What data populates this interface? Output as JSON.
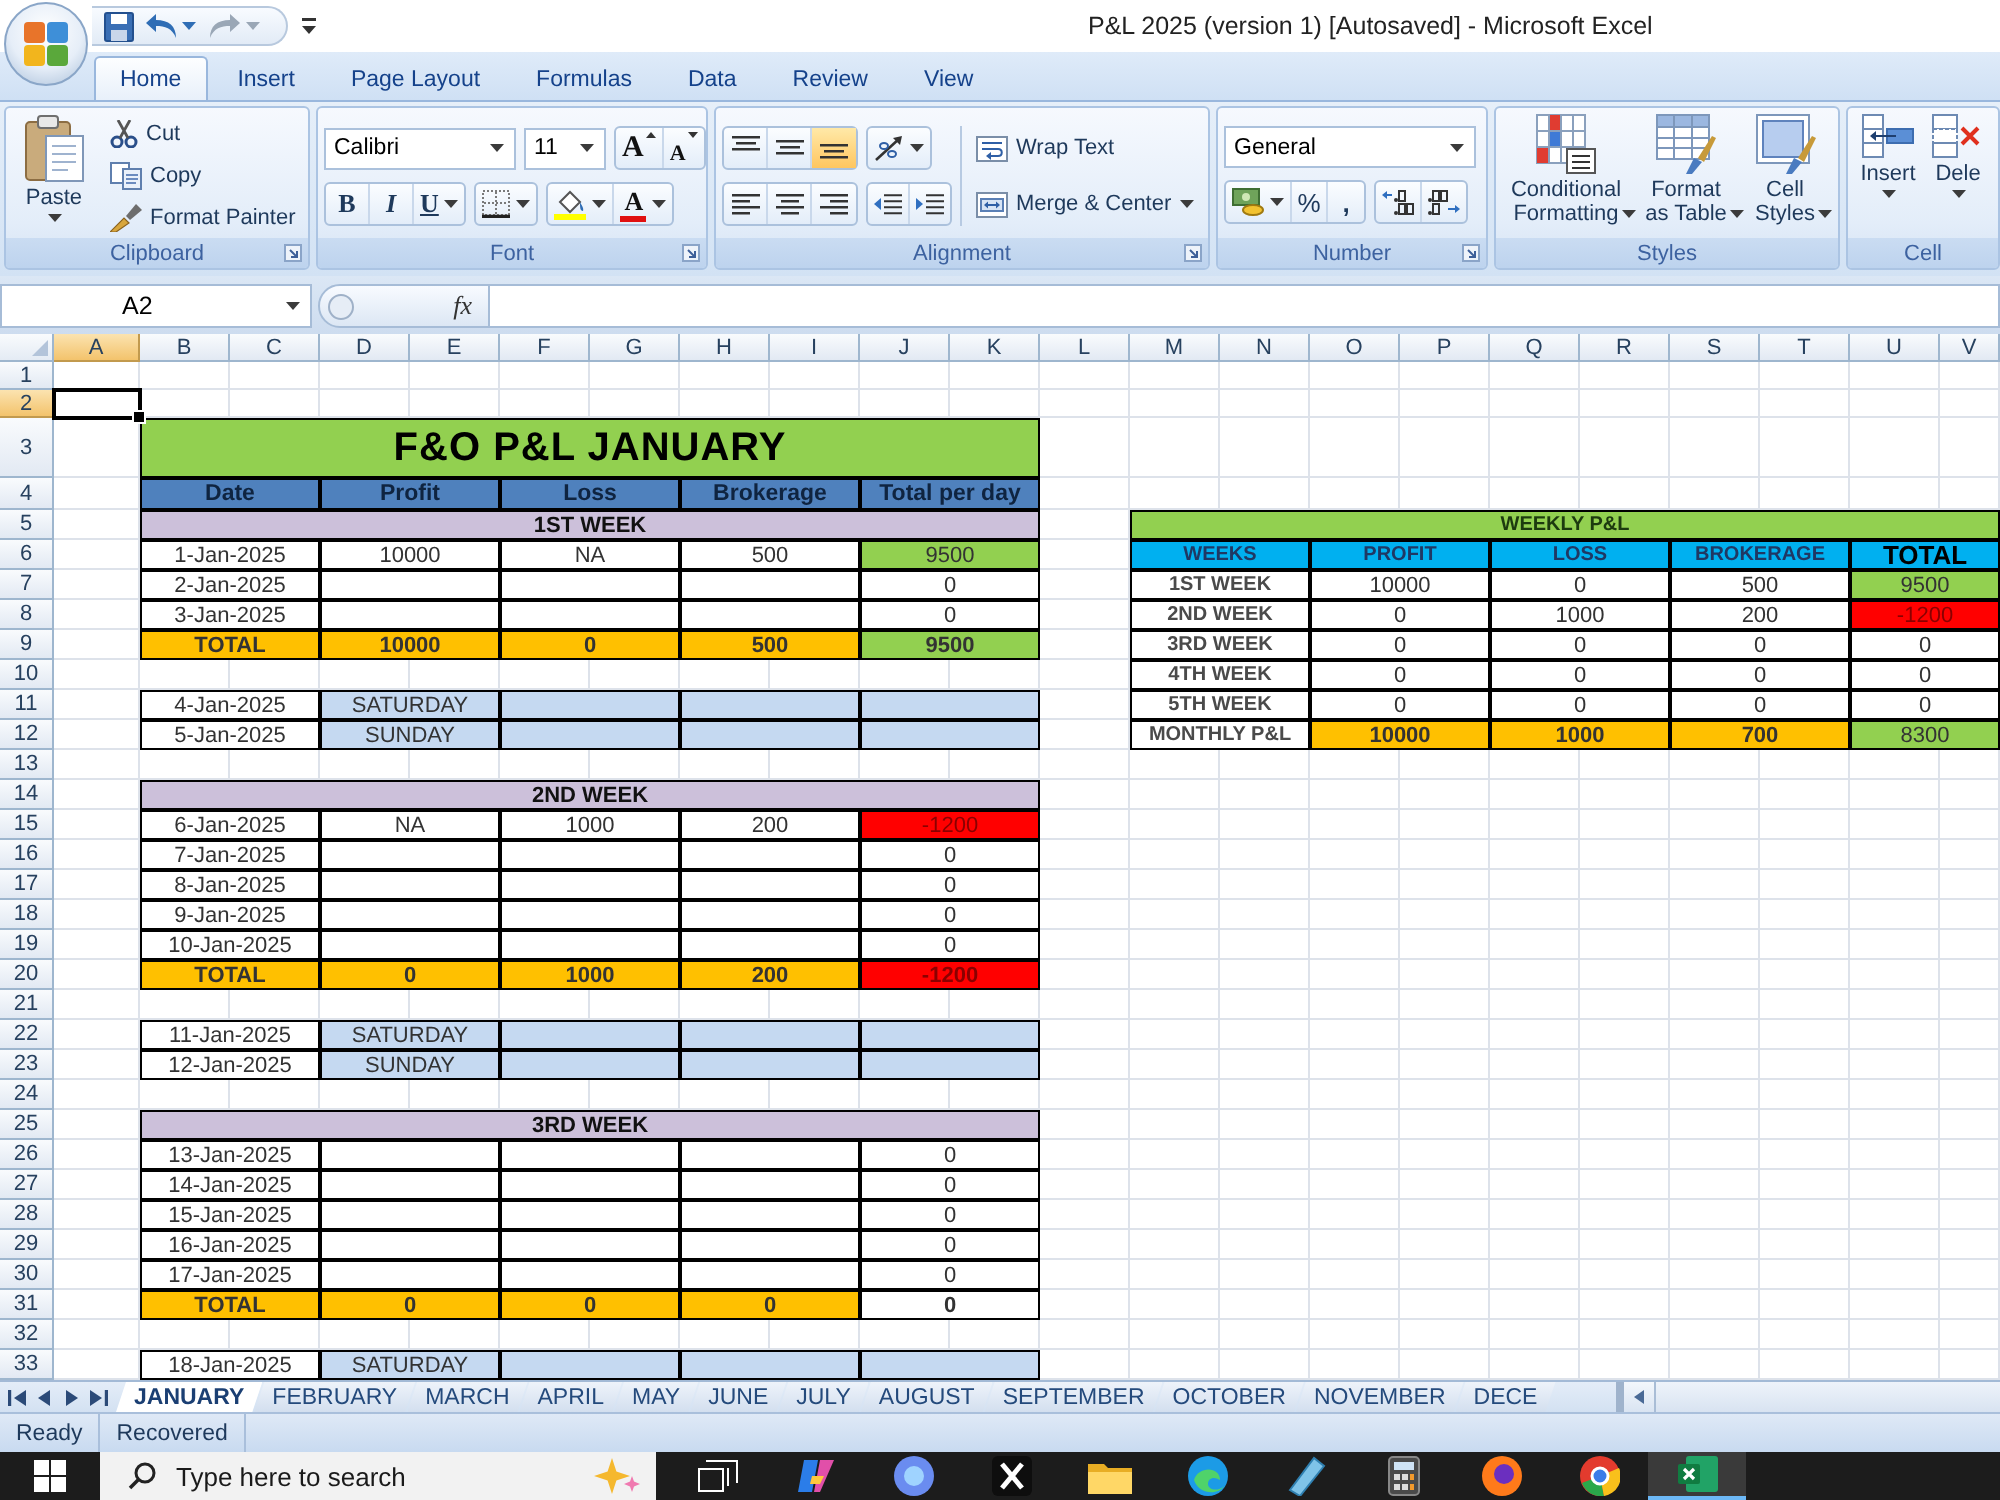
{
  "window": {
    "title": "P&L 2025 (version 1) [Autosaved] - Microsoft Excel"
  },
  "quick_access": {
    "undo": {
      "disabled": false
    },
    "redo": {
      "disabled": true
    }
  },
  "ribbon": {
    "tabs": [
      {
        "label": "Home",
        "selected": true
      },
      {
        "label": "Insert",
        "selected": false
      },
      {
        "label": "Page Layout",
        "selected": false
      },
      {
        "label": "Formulas",
        "selected": false
      },
      {
        "label": "Data",
        "selected": false
      },
      {
        "label": "Review",
        "selected": false
      },
      {
        "label": "View",
        "selected": false
      }
    ],
    "clipboard": {
      "label": "Clipboard",
      "paste": "Paste",
      "commands": [
        "Cut",
        "Copy",
        "Format Painter"
      ]
    },
    "font": {
      "label": "Font",
      "font_name": "Calibri",
      "font_size": "11",
      "grow": "A",
      "shrink": "A",
      "styles": [
        "B",
        "I",
        "U"
      ],
      "font_color": "A"
    },
    "alignment": {
      "label": "Alignment",
      "vertical": [
        {
          "selected": false
        },
        {
          "selected": false
        },
        {
          "selected": true
        }
      ],
      "wrap_text": "Wrap Text",
      "merge": "Merge & Center"
    },
    "number": {
      "label": "Number",
      "format": "General",
      "percent": "%",
      "comma": ","
    },
    "styles": {
      "label": "Styles",
      "commands": [
        "Conditional Formatting",
        "Format as Table",
        "Cell Styles"
      ]
    },
    "cells": {
      "label": "Cell",
      "commands": [
        "Insert",
        "Dele"
      ]
    }
  },
  "formula_bar": {
    "name_box": "A2",
    "function_label": "fx"
  },
  "sheet": {
    "columns": [
      {
        "label": "A",
        "selected": true
      },
      {
        "label": "B",
        "selected": false
      },
      {
        "label": "C",
        "selected": false
      },
      {
        "label": "D",
        "selected": false
      },
      {
        "label": "E",
        "selected": false
      },
      {
        "label": "F",
        "selected": false
      },
      {
        "label": "G",
        "selected": false
      },
      {
        "label": "H",
        "selected": false
      },
      {
        "label": "I",
        "selected": false
      },
      {
        "label": "J",
        "selected": false
      },
      {
        "label": "K",
        "selected": false
      },
      {
        "label": "L",
        "selected": false
      },
      {
        "label": "M",
        "selected": false
      },
      {
        "label": "N",
        "selected": false
      },
      {
        "label": "O",
        "selected": false
      },
      {
        "label": "P",
        "selected": false
      },
      {
        "label": "Q",
        "selected": false
      },
      {
        "label": "R",
        "selected": false
      },
      {
        "label": "S",
        "selected": false
      },
      {
        "label": "T",
        "selected": false
      },
      {
        "label": "U",
        "selected": false
      },
      {
        "label": "V",
        "selected": false
      }
    ],
    "rows": [
      {
        "label": "1",
        "selected": false
      },
      {
        "label": "2",
        "selected": true
      },
      {
        "label": "3",
        "selected": false
      },
      {
        "label": "4",
        "selected": false
      },
      {
        "label": "5",
        "selected": false
      },
      {
        "label": "6",
        "selected": false
      },
      {
        "label": "7",
        "selected": false
      },
      {
        "label": "8",
        "selected": false
      },
      {
        "label": "9",
        "selected": false
      },
      {
        "label": "10",
        "selected": false
      },
      {
        "label": "11",
        "selected": false
      },
      {
        "label": "12",
        "selected": false
      },
      {
        "label": "13",
        "selected": false
      },
      {
        "label": "14",
        "selected": false
      },
      {
        "label": "15",
        "selected": false
      },
      {
        "label": "16",
        "selected": false
      },
      {
        "label": "17",
        "selected": false
      },
      {
        "label": "18",
        "selected": false
      },
      {
        "label": "19",
        "selected": false
      },
      {
        "label": "20",
        "selected": false
      },
      {
        "label": "21",
        "selected": false
      },
      {
        "label": "22",
        "selected": false
      },
      {
        "label": "23",
        "selected": false
      },
      {
        "label": "24",
        "selected": false
      },
      {
        "label": "25",
        "selected": false
      },
      {
        "label": "26",
        "selected": false
      },
      {
        "label": "27",
        "selected": false
      },
      {
        "label": "28",
        "selected": false
      },
      {
        "label": "29",
        "selected": false
      },
      {
        "label": "30",
        "selected": false
      },
      {
        "label": "31",
        "selected": false
      },
      {
        "label": "32",
        "selected": false
      },
      {
        "label": "33",
        "selected": false
      }
    ],
    "january_table": {
      "title": "F&O P&L JANUARY",
      "columns": [
        "Date",
        "Profit",
        "Loss",
        "Brokerage",
        "Total per day"
      ],
      "weeks": [
        {
          "label": "1ST WEEK",
          "days": [
            {
              "date": "1-Jan-2025",
              "profit": "10000",
              "loss": "NA",
              "brokerage": "500",
              "total": "9500",
              "color": "#92d050"
            },
            {
              "date": "2-Jan-2025",
              "total": "0",
              "color": "#ffffff"
            },
            {
              "date": "3-Jan-2025",
              "total": "0",
              "color": "#ffffff"
            }
          ],
          "total": {
            "label": "TOTAL",
            "profit": "10000",
            "loss": "0",
            "brokerage": "500",
            "total": "9500",
            "color": "#92d050"
          },
          "weekend": [
            {
              "date": "4-Jan-2025",
              "day": "SATURDAY"
            },
            {
              "date": "5-Jan-2025",
              "day": "SUNDAY"
            }
          ]
        },
        {
          "label": "2ND WEEK",
          "days": [
            {
              "date": "6-Jan-2025",
              "profit": "NA",
              "loss": "1000",
              "brokerage": "200",
              "total": "-1200",
              "color": "#ff0000"
            },
            {
              "date": "7-Jan-2025",
              "total": "0",
              "color": "#ffffff"
            },
            {
              "date": "8-Jan-2025",
              "total": "0",
              "color": "#ffffff"
            },
            {
              "date": "9-Jan-2025",
              "total": "0",
              "color": "#ffffff"
            },
            {
              "date": "10-Jan-2025",
              "total": "0",
              "color": "#ffffff"
            }
          ],
          "total": {
            "label": "TOTAL",
            "profit": "0",
            "loss": "1000",
            "brokerage": "200",
            "total": "-1200",
            "color": "#ff0000"
          },
          "weekend": [
            {
              "date": "11-Jan-2025",
              "day": "SATURDAY"
            },
            {
              "date": "12-Jan-2025",
              "day": "SUNDAY"
            }
          ]
        },
        {
          "label": "3RD WEEK",
          "days": [
            {
              "date": "13-Jan-2025",
              "total": "0",
              "color": "#ffffff"
            },
            {
              "date": "14-Jan-2025",
              "total": "0",
              "color": "#ffffff"
            },
            {
              "date": "15-Jan-2025",
              "total": "0",
              "color": "#ffffff"
            },
            {
              "date": "16-Jan-2025",
              "total": "0",
              "color": "#ffffff"
            },
            {
              "date": "17-Jan-2025",
              "total": "0",
              "color": "#ffffff"
            }
          ],
          "total": {
            "label": "TOTAL",
            "profit": "0",
            "loss": "0",
            "brokerage": "0",
            "total": "0",
            "color": "#ffffff"
          },
          "weekend": [
            {
              "date": "18-Jan-2025",
              "day": "SATURDAY"
            }
          ]
        }
      ]
    },
    "weekly_table": {
      "title": "WEEKLY P&L",
      "columns": [
        "WEEKS",
        "PROFIT",
        "LOSS",
        "BROKERAGE",
        "TOTAL"
      ],
      "rows": [
        {
          "week": "1ST WEEK",
          "profit": "10000",
          "loss": "0",
          "brokerage": "500",
          "total": "9500",
          "color": "#92d050"
        },
        {
          "week": "2ND WEEK",
          "profit": "0",
          "loss": "1000",
          "brokerage": "200",
          "total": "-1200",
          "color": "#ff0000"
        },
        {
          "week": "3RD WEEK",
          "profit": "0",
          "loss": "0",
          "brokerage": "0",
          "total": "0",
          "color": "#ffffff"
        },
        {
          "week": "4TH WEEK",
          "profit": "0",
          "loss": "0",
          "brokerage": "0",
          "total": "0",
          "color": "#ffffff"
        },
        {
          "week": "5TH WEEK",
          "profit": "0",
          "loss": "0",
          "brokerage": "0",
          "total": "0",
          "color": "#ffffff"
        }
      ],
      "summary": {
        "week": "MONTHLY P&L",
        "profit": "10000",
        "loss": "1000",
        "brokerage": "700",
        "total": "8300",
        "color": "#92d050"
      }
    }
  },
  "sheet_tabs": [
    {
      "label": "JANUARY",
      "selected": true
    },
    {
      "label": "FEBRUARY",
      "selected": false
    },
    {
      "label": "MARCH",
      "selected": false
    },
    {
      "label": "APRIL",
      "selected": false
    },
    {
      "label": "MAY",
      "selected": false
    },
    {
      "label": "JUNE",
      "selected": false
    },
    {
      "label": "JULY",
      "selected": false
    },
    {
      "label": "AUGUST",
      "selected": false
    },
    {
      "label": "SEPTEMBER",
      "selected": false
    },
    {
      "label": "OCTOBER",
      "selected": false
    },
    {
      "label": "NOVEMBER",
      "selected": false
    },
    {
      "label": "DECE",
      "selected": false
    }
  ],
  "status_bar": [
    "Ready",
    "Recovered"
  ],
  "taskbar": {
    "search": {
      "placeholder": "Type here to search"
    },
    "buttons": [
      {
        "selected": false
      },
      {
        "selected": false
      },
      {
        "selected": false
      },
      {
        "selected": false
      },
      {
        "selected": false
      },
      {
        "selected": false
      },
      {
        "selected": false
      },
      {
        "selected": false
      },
      {
        "selected": false
      },
      {
        "selected": false
      },
      {
        "selected": true
      }
    ]
  }
}
